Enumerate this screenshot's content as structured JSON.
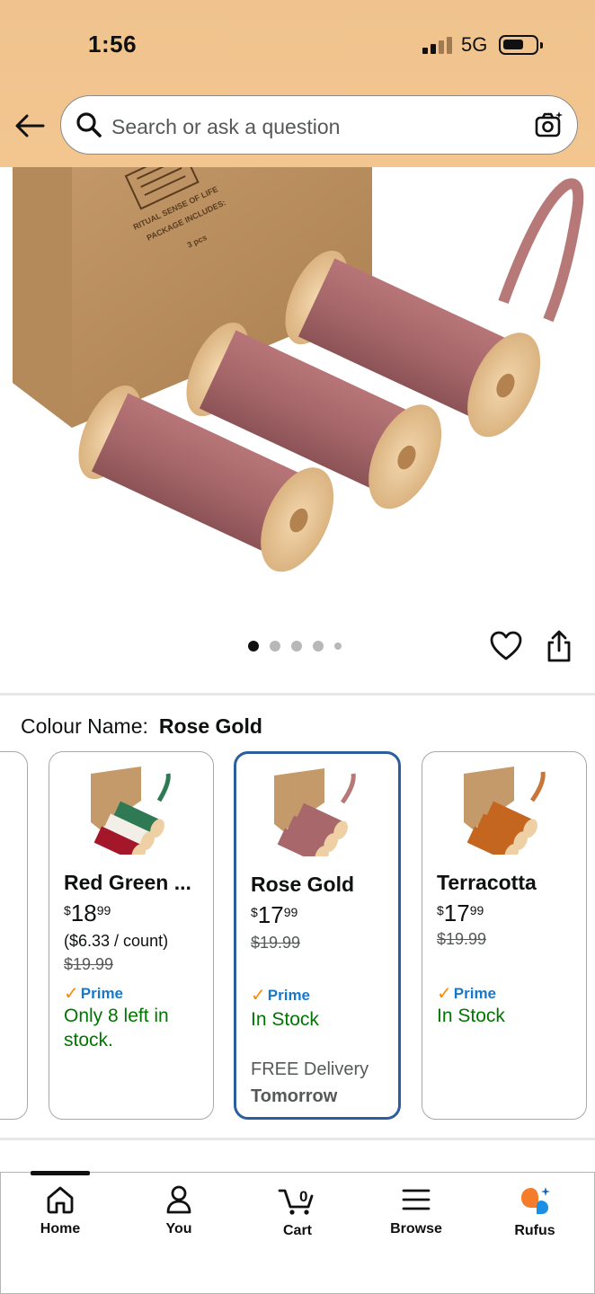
{
  "status_bar": {
    "time": "1:56",
    "network": "5G"
  },
  "search": {
    "placeholder": "Search or ask a question"
  },
  "carousel": {
    "total_dots": 5,
    "active_index": 0
  },
  "colour": {
    "label": "Colour Name:",
    "value": "Rose Gold"
  },
  "variants": [
    {
      "name": "Red Green ...",
      "price_dollars": "18",
      "price_cents": "99",
      "currency": "$",
      "unit_price": "($6.33 / count)",
      "list_price": "$19.99",
      "prime": "Prime",
      "stock": "Only 8 left in stock.",
      "selected": false
    },
    {
      "name": "Rose Gold",
      "price_dollars": "17",
      "price_cents": "99",
      "currency": "$",
      "list_price": "$19.99",
      "prime": "Prime",
      "stock": "In Stock",
      "delivery": "FREE Delivery",
      "delivery_day": "Tomorrow",
      "selected": true
    },
    {
      "name": "Terracotta",
      "price_dollars": "17",
      "price_cents": "99",
      "currency": "$",
      "list_price": "$19.99",
      "prime": "Prime",
      "stock": "In Stock",
      "selected": false
    }
  ],
  "bottom_nav": {
    "items": [
      {
        "label": "Home",
        "icon": "home-icon",
        "active": true
      },
      {
        "label": "You",
        "icon": "person-icon"
      },
      {
        "label": "Cart",
        "icon": "cart-icon",
        "badge": "0"
      },
      {
        "label": "Browse",
        "icon": "menu-icon"
      },
      {
        "label": "Rufus",
        "icon": "rufus-icon"
      }
    ]
  },
  "colors": {
    "accent_blue": "#2b5e9b",
    "prime_blue": "#1a78c9",
    "stock_green": "#007600",
    "header_bg": "#f2c590",
    "ribbon": "#a8676a",
    "rufus_orange": "#f57c2b"
  }
}
